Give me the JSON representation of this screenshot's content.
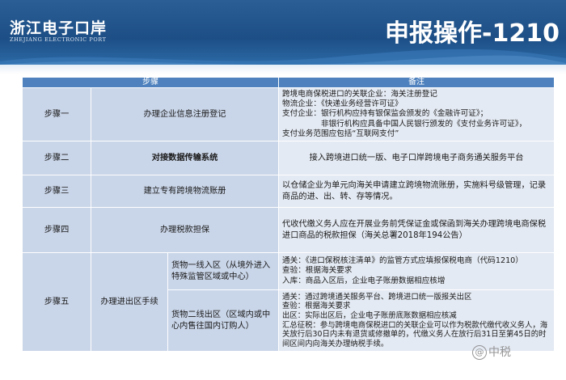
{
  "header": {
    "logo_cn": "浙江电子口岸",
    "logo_en": "ZHEJIANG ELECTRONIC PORT",
    "title": "申报操作-1210"
  },
  "table": {
    "col_step": "步骤",
    "col_note": "备注",
    "rows": [
      {
        "step": "步骤一",
        "action": "办理企业信息注册登记",
        "note_lines": [
          "跨境电商保税进口的关联企业：海关注册登记",
          "物流企业：《快递业务经营许可证》",
          "支付企业：银行机构应持有银保监会颁发的《金融许可证》；",
          "　　　　　非银行机构应具备中国人民银行颁发的《支付业务许可证》，",
          "支付业务范围应包括“互联网支付”"
        ]
      },
      {
        "step": "步骤二",
        "action": "对接数据传输系统",
        "note": "接入跨境进口统一版、电子口岸跨境电子商务通关服务平台"
      },
      {
        "step": "步骤三",
        "action": "建立专有跨境物流账册",
        "note": "以仓储企业为单元向海关申请建立跨境物流账册，实施料号级管理，记录商品的进、出、转、存等情况。"
      },
      {
        "step": "步骤四",
        "action": "办理税款担保",
        "note": "代收代缴义务人应在开展业务前凭保证金或保函到海关办理跨境电商保税进口商品的税款担保（海关总署2018年194公告）"
      },
      {
        "step": "步骤五",
        "action": "办理进出区手续",
        "sub": [
          {
            "label": "货物一线入区（从境外进入特殊监管区域或中心）",
            "note_lines": [
              "通关：《进口保税核注清单》的监管方式应填报保税电商（代码1210）",
              "查验：根据海关要求",
              "入库：商品入区后，企业电子账册数据相应核增"
            ]
          },
          {
            "label": "货物二线出区（区域内或中心内售往国内订购人）",
            "note_lines": [
              "通关：通过跨境通关服务平台、跨境进口统一版报关出区",
              "查验：根据海关要求",
              "出区：实际出区后，企业电子账册底账数据相应核减",
              "汇总征税：参与跨境电商保税进口的关联企业可以作为税款代缴代收义务人，海关放行后30日内未有退货或修撤单的，代缴义务人在放行后31日至第45日的时间区间内向海关办理纳税手续。"
            ]
          }
        ]
      }
    ]
  },
  "watermark": "中税"
}
